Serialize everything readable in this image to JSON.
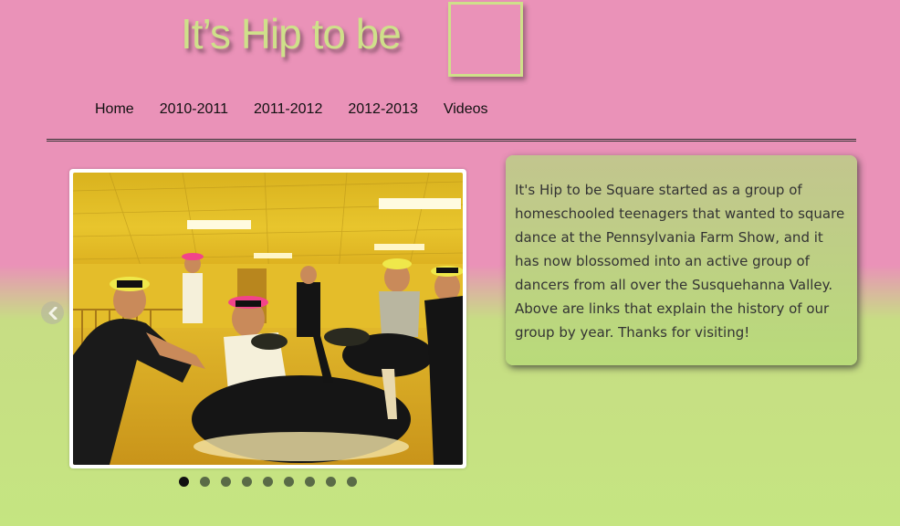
{
  "header": {
    "title": "It’s Hip to be"
  },
  "nav": {
    "items": [
      {
        "label": "Home"
      },
      {
        "label": "2010-2011"
      },
      {
        "label": "2011-2012"
      },
      {
        "label": "2012-2013"
      },
      {
        "label": "Videos"
      }
    ]
  },
  "slider": {
    "prev_icon": "chevron-left-icon",
    "current_slide": 1,
    "slide_count": 9
  },
  "info": {
    "text": "It's Hip to be Square started as a group of homeschooled teenagers that wanted to square dance at the Pennsylvania Farm Show, and it has now blossomed into an active group of dancers from all over the Susquehanna Valley. Above are links that explain the history of our group by year. Thanks for visiting!"
  },
  "colors": {
    "pink_background": "#ea92b8",
    "green_background": "#c5e581",
    "title_green": "#cfe08a",
    "active_dot": "#111111",
    "inactive_dot": "#5a6b47"
  }
}
